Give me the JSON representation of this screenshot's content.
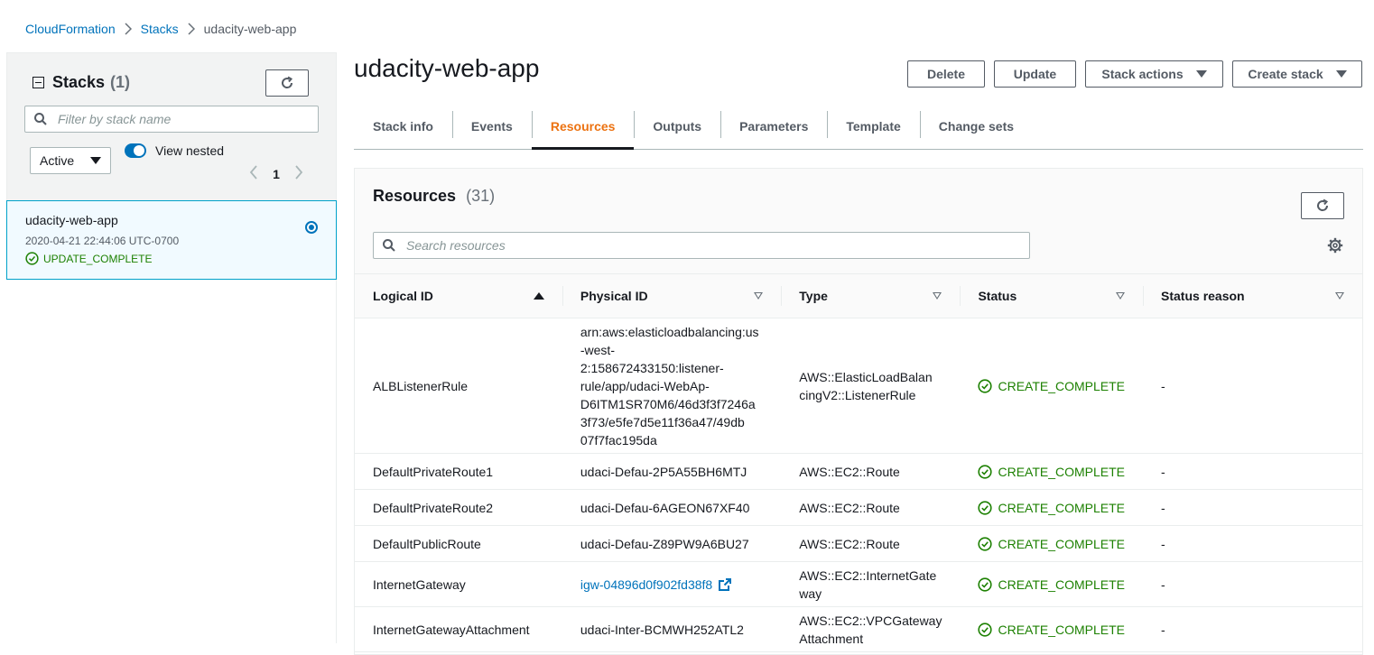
{
  "breadcrumb": {
    "items": [
      "CloudFormation",
      "Stacks",
      "udacity-web-app"
    ]
  },
  "left": {
    "title": "Stacks",
    "count": "(1)",
    "filter_placeholder": "Filter by stack name",
    "filter_value": "Active",
    "view_nested_label": "View nested",
    "page": "1",
    "stack": {
      "name": "udacity-web-app",
      "date": "2020-04-21 22:44:06 UTC-0700",
      "status": "UPDATE_COMPLETE"
    }
  },
  "main": {
    "title": "udacity-web-app",
    "buttons": {
      "delete": "Delete",
      "update": "Update",
      "stack_actions": "Stack actions",
      "create_stack": "Create stack"
    },
    "tabs": [
      "Stack info",
      "Events",
      "Resources",
      "Outputs",
      "Parameters",
      "Template",
      "Change sets"
    ],
    "active_tab": "Resources",
    "resources": {
      "title": "Resources",
      "count": "(31)",
      "search_placeholder": "Search resources",
      "columns": [
        "Logical ID",
        "Physical ID",
        "Type",
        "Status",
        "Status reason"
      ],
      "rows": [
        {
          "logical_id": "ALBListenerRule",
          "physical_id_lines": [
            "arn:aws:elasticloadbalancing:us",
            "-west-",
            "2:158672433150:listener-",
            "rule/app/udaci-WebAp-",
            "D6ITM1SR70M6/46d3f3f7246a",
            "3f73/e5fe7d5e11f36a47/49db",
            "07f7fac195da"
          ],
          "type_lines": [
            "AWS::ElasticLoadBalan",
            "cingV2::ListenerRule"
          ],
          "status": "CREATE_COMPLETE",
          "reason": "-"
        },
        {
          "logical_id": "DefaultPrivateRoute1",
          "physical_id_lines": [
            "udaci-Defau-2P5A55BH6MTJ"
          ],
          "type_lines": [
            "AWS::EC2::Route"
          ],
          "status": "CREATE_COMPLETE",
          "reason": "-"
        },
        {
          "logical_id": "DefaultPrivateRoute2",
          "physical_id_lines": [
            "udaci-Defau-6AGEON67XF40"
          ],
          "type_lines": [
            "AWS::EC2::Route"
          ],
          "status": "CREATE_COMPLETE",
          "reason": "-"
        },
        {
          "logical_id": "DefaultPublicRoute",
          "physical_id_lines": [
            "udaci-Defau-Z89PW9A6BU27"
          ],
          "type_lines": [
            "AWS::EC2::Route"
          ],
          "status": "CREATE_COMPLETE",
          "reason": "-"
        },
        {
          "logical_id": "InternetGateway",
          "physical_id_lines": [
            "igw-04896d0f902fd38f8"
          ],
          "physical_is_link": true,
          "type_lines": [
            "AWS::EC2::InternetGate",
            "way"
          ],
          "status": "CREATE_COMPLETE",
          "reason": "-"
        },
        {
          "logical_id": "InternetGatewayAttachment",
          "physical_id_lines": [
            "udaci-Inter-BCMWH252ATL2"
          ],
          "type_lines": [
            "AWS::EC2::VPCGateway",
            "Attachment"
          ],
          "status": "CREATE_COMPLETE",
          "reason": "-"
        }
      ]
    }
  },
  "colors": {
    "link": "#0073bb",
    "success": "#1d8102",
    "active_tab": "#ec7211"
  }
}
